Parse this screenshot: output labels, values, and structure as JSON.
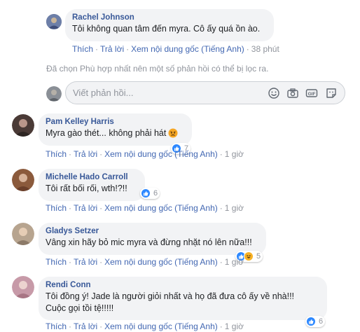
{
  "comments": [
    {
      "author": "Rachel Johnson",
      "text": "Tôi không quan tâm đến myra. Cô ấy quá ồn ào.",
      "actions": {
        "like": "Thích",
        "reply": "Trả lời",
        "original": "Xem nội dung gốc (Tiếng Anh)",
        "time": "38 phút"
      }
    },
    {
      "author": "Pam Kelley Harris",
      "text": "Myra gào thét... không phải hát",
      "emoji": "angry-face-icon",
      "reactions": 7,
      "actions": {
        "like": "Thích",
        "reply": "Trả lời",
        "original": "Xem nội dung gốc (Tiếng Anh)",
        "time": "1 giờ"
      }
    },
    {
      "author": "Michelle Hado Carroll",
      "text": "Tôi rất bối rối, wth!?!!",
      "reactions": 6,
      "actions": {
        "like": "Thích",
        "reply": "Trả lời",
        "original": "Xem nội dung gốc (Tiếng Anh)",
        "time": "1 giờ"
      }
    },
    {
      "author": "Gladys Setzer",
      "text": "Vâng xin hãy bỏ mic myra và đừng nhặt nó lên nữa!!!",
      "reactions": 5,
      "actions": {
        "like": "Thích",
        "reply": "Trả lời",
        "original": "Xem nội dung gốc (Tiếng Anh)",
        "time": "1 giờ"
      }
    },
    {
      "author": "Rendi Conn",
      "text_line1": "Tôi đồng ý! Jade là người giỏi nhất và họ đã đưa cô ấy về nhà!!!",
      "text_line2": "Cuộc gọi tồi tệ!!!!!",
      "reactions": 6,
      "actions": {
        "like": "Thích",
        "reply": "Trả lời",
        "original": "Xem nội dung gốc (Tiếng Anh)",
        "time": "1 giờ"
      }
    }
  ],
  "filter_note": "Đã chọn Phù hợp nhất nên một số phản hồi có thể bị lọc ra.",
  "reply_input": {
    "placeholder": "Viết phản hồi..."
  },
  "colors": {
    "link": "#4267b2",
    "name": "#385898",
    "bubble": "#f2f3f5",
    "muted": "#90949c",
    "like": "#2d88ff"
  }
}
